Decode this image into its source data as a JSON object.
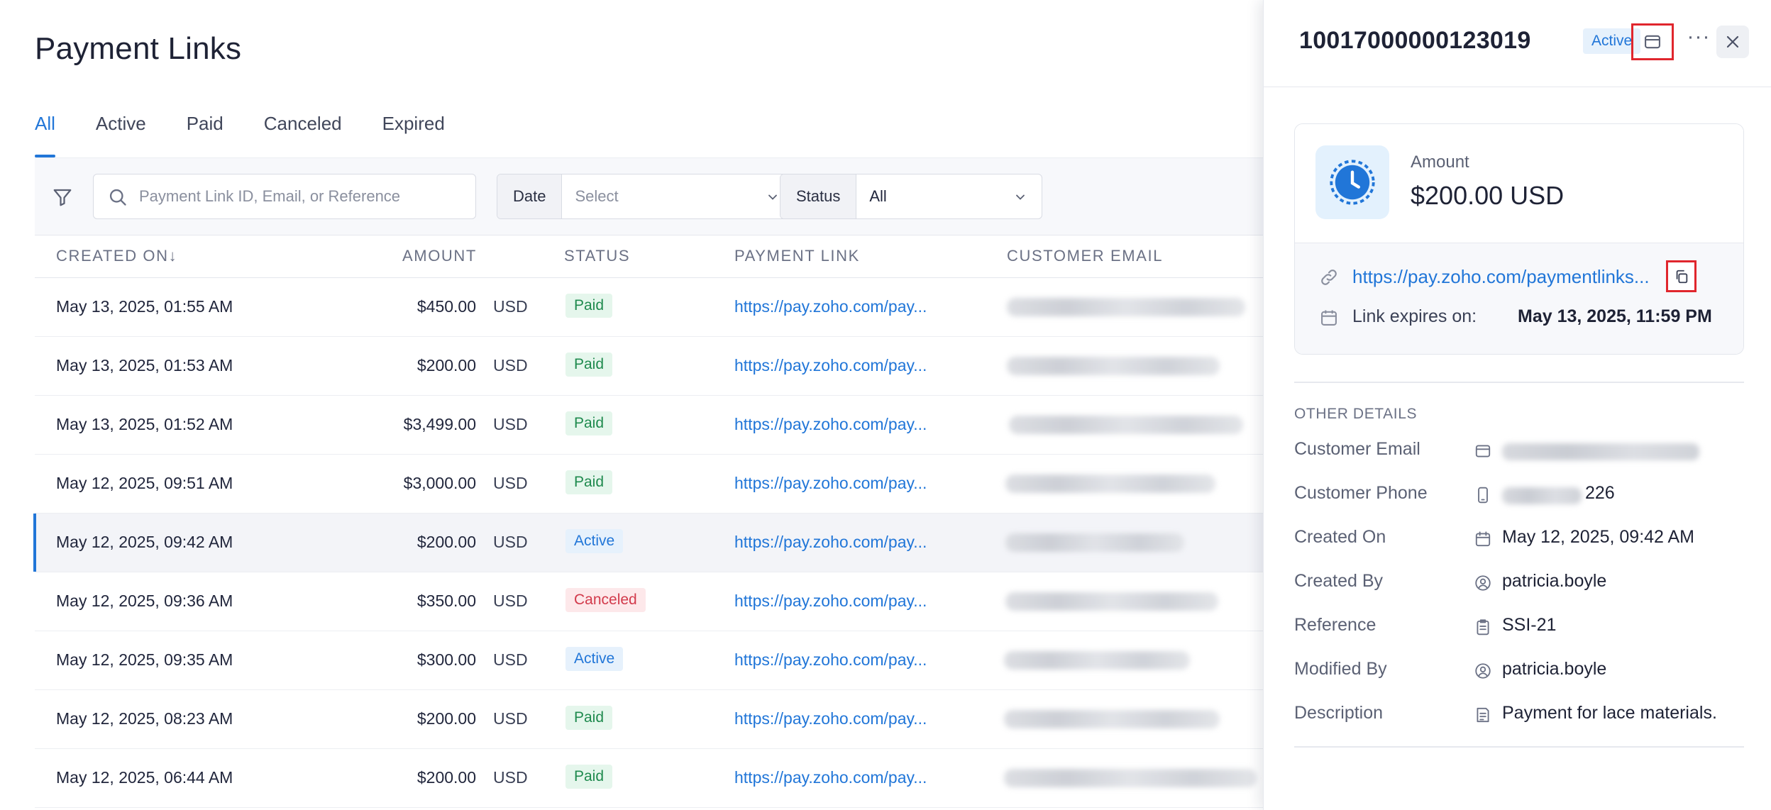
{
  "page": {
    "title": "Payment Links",
    "tabs": [
      "All",
      "Active",
      "Paid",
      "Canceled",
      "Expired"
    ],
    "active_tab": "All"
  },
  "filters": {
    "search_placeholder": "Payment Link ID, Email, or Reference",
    "date_label": "Date",
    "date_value": "Select",
    "status_label": "Status",
    "status_value": "All"
  },
  "table": {
    "headers": {
      "created_on": "CREATED ON",
      "sort_arrow": "↓",
      "amount": "AMOUNT",
      "status": "STATUS",
      "payment_link": "PAYMENT LINK",
      "customer_email": "CUSTOMER EMAIL"
    },
    "rows": [
      {
        "created_on": "May 13, 2025, 01:55 AM",
        "amount": "$450.00",
        "currency": "USD",
        "status": "Paid",
        "link": "https://pay.zoho.com/pay..."
      },
      {
        "created_on": "May 13, 2025, 01:53 AM",
        "amount": "$200.00",
        "currency": "USD",
        "status": "Paid",
        "link": "https://pay.zoho.com/pay..."
      },
      {
        "created_on": "May 13, 2025, 01:52 AM",
        "amount": "$3,499.00",
        "currency": "USD",
        "status": "Paid",
        "link": "https://pay.zoho.com/pay..."
      },
      {
        "created_on": "May 12, 2025, 09:51 AM",
        "amount": "$3,000.00",
        "currency": "USD",
        "status": "Paid",
        "link": "https://pay.zoho.com/pay..."
      },
      {
        "created_on": "May 12, 2025, 09:42 AM",
        "amount": "$200.00",
        "currency": "USD",
        "status": "Active",
        "link": "https://pay.zoho.com/pay..."
      },
      {
        "created_on": "May 12, 2025, 09:36 AM",
        "amount": "$350.00",
        "currency": "USD",
        "status": "Canceled",
        "link": "https://pay.zoho.com/pay..."
      },
      {
        "created_on": "May 12, 2025, 09:35 AM",
        "amount": "$300.00",
        "currency": "USD",
        "status": "Active",
        "link": "https://pay.zoho.com/pay..."
      },
      {
        "created_on": "May 12, 2025, 08:23 AM",
        "amount": "$200.00",
        "currency": "USD",
        "status": "Paid",
        "link": "https://pay.zoho.com/pay..."
      },
      {
        "created_on": "May 12, 2025, 06:44 AM",
        "amount": "$200.00",
        "currency": "USD",
        "status": "Paid",
        "link": "https://pay.zoho.com/pay..."
      }
    ],
    "selected_row": 4
  },
  "panel": {
    "id": "10017000000123019",
    "status": "Active",
    "icons": {
      "mail": "mail-icon",
      "more": "more-icon",
      "close": "close-icon"
    },
    "amount_label": "Amount",
    "amount_value": "$200.00 USD",
    "link": "https://pay.zoho.com/paymentlinks...",
    "expires_label": "Link expires on:",
    "expires_value": "May 13, 2025, 11:59 PM",
    "other_details_title": "OTHER DETAILS",
    "details": [
      {
        "key": "Customer Email",
        "value": "",
        "icon": "mail-icon"
      },
      {
        "key": "Customer Phone",
        "value": "226",
        "icon": "phone-icon"
      },
      {
        "key": "Created On",
        "value": "May 12, 2025, 09:42 AM",
        "icon": "calendar-icon"
      },
      {
        "key": "Created By",
        "value": "patricia.boyle",
        "icon": "user-icon"
      },
      {
        "key": "Reference",
        "value": "SSI-21",
        "icon": "clipboard-icon"
      },
      {
        "key": "Modified By",
        "value": "patricia.boyle",
        "icon": "user-icon"
      },
      {
        "key": "Description",
        "value": "Payment for lace materials.",
        "icon": "note-icon"
      }
    ]
  },
  "colors": {
    "accent": "#2176d8",
    "paid_bg": "#e5f6ec",
    "paid_fg": "#1f8a4e",
    "active_bg": "#e6f1fc",
    "canceled_bg": "#fde8ea",
    "canceled_fg": "#d23a4b",
    "highlight_border": "#e0262d"
  }
}
